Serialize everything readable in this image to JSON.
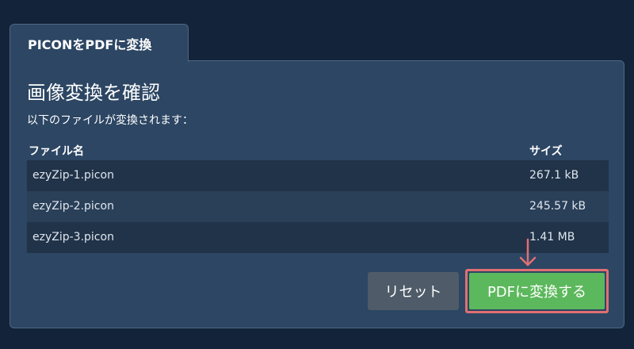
{
  "tab": {
    "label": "PICONをPDFに変換"
  },
  "panel": {
    "title": "画像変換を確認",
    "subtitle": "以下のファイルが変換されます："
  },
  "table": {
    "headers": {
      "name": "ファイル名",
      "size": "サイズ"
    },
    "rows": [
      {
        "name": "ezyZip-1.picon",
        "size": "267.1 kB"
      },
      {
        "name": "ezyZip-2.picon",
        "size": "245.57 kB"
      },
      {
        "name": "ezyZip-3.picon",
        "size": "1.41 MB"
      }
    ]
  },
  "buttons": {
    "reset_label": "リセット",
    "convert_label": "PDFに変換する"
  },
  "colors": {
    "background": "#12233a",
    "panel": "#2c4663",
    "convert_button": "#5cb85c",
    "highlight": "#e06f72",
    "reset_button": "#4f5b68"
  },
  "icons": {
    "pointer": "down-arrow-icon"
  }
}
